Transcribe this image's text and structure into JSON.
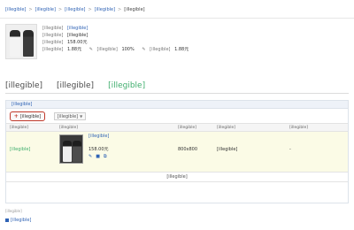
{
  "breadcrumb": {
    "items": [
      "[illegible]",
      "[illegible]",
      "[illegible]",
      "[illegible]",
      "[illegible]"
    ],
    "separator": ">"
  },
  "product": {
    "title_label": "[illegible]",
    "title": "[illegible]",
    "category_label": "[illegible]",
    "category": "[illegible]",
    "price_label": "[illegible]",
    "price": "158.00元",
    "bid_row": {
      "default_bid_label": "[illegible]",
      "default_bid": "1.88元",
      "mobile_discount_label": "[illegible]",
      "mobile_discount": "100%",
      "mobile_bid_label": "[illegible]",
      "mobile_bid": "1.88元"
    }
  },
  "tabs": [
    {
      "label": "[illegible]",
      "active": false
    },
    {
      "label": "[illegible]",
      "active": false
    },
    {
      "label": "[illegible]",
      "active": true
    }
  ],
  "panel": {
    "title": "[illegible]",
    "add_button": "[illegible]",
    "flow_button": "[illegible]",
    "columns": {
      "status": "[illegible]",
      "creative": "[illegible]",
      "size": "[illegible]",
      "device": "[illegible]",
      "impressions": "[illegible]"
    },
    "row": {
      "status": "[illegible]",
      "title": "[illegible]",
      "price": "158.00元",
      "size": "800x800",
      "device": "[illegible]",
      "impressions": "-"
    },
    "total": "[illegible]"
  },
  "note": "[illegible]",
  "manage_link": "[illegible]",
  "colors": {
    "link": "#2f63b5",
    "accent_green": "#3fae6d",
    "highlight_row": "#fbfbe6",
    "add_button_border": "#c0392b"
  },
  "icons": [
    "edit-icon",
    "plus-icon",
    "caret-down-icon",
    "creative-edit-icon",
    "creative-delete-icon",
    "creative-copy-icon",
    "manage-icon"
  ]
}
